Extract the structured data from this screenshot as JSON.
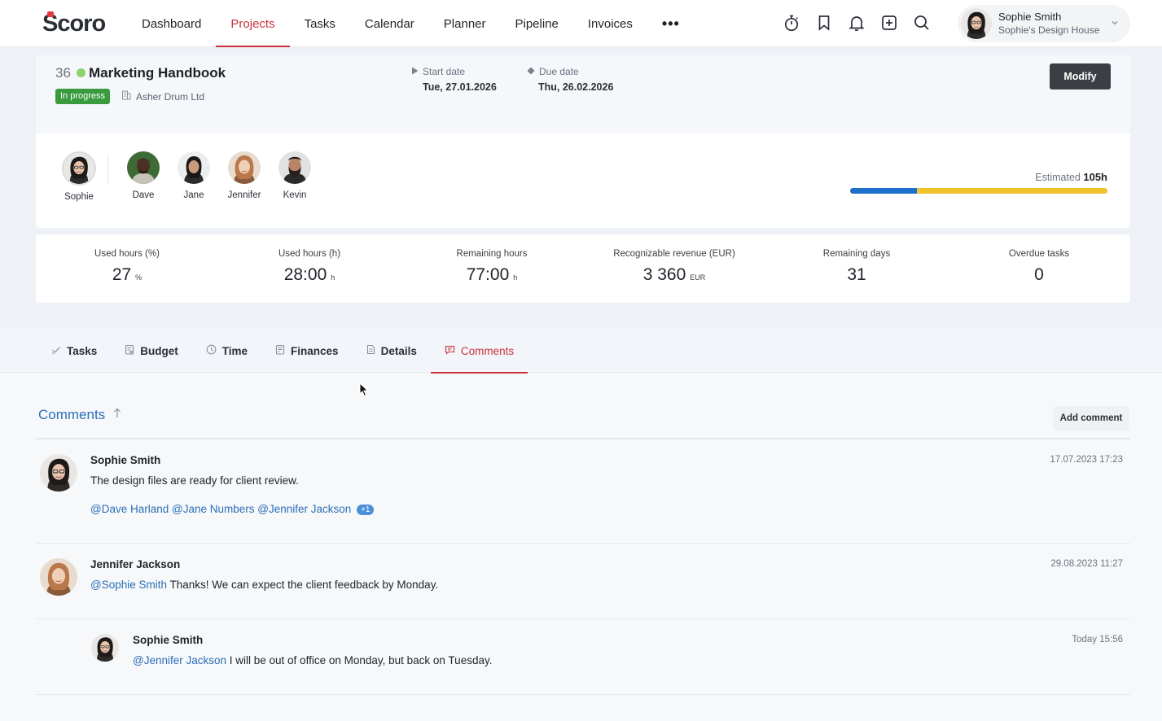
{
  "nav": {
    "logo": "Scoro",
    "items": [
      {
        "label": "Dashboard",
        "active": false
      },
      {
        "label": "Projects",
        "active": true
      },
      {
        "label": "Tasks",
        "active": false
      },
      {
        "label": "Calendar",
        "active": false
      },
      {
        "label": "Planner",
        "active": false
      },
      {
        "label": "Pipeline",
        "active": false
      },
      {
        "label": "Invoices",
        "active": false
      }
    ],
    "more_label": "•••",
    "icons": [
      "stopwatch-icon",
      "bookmark-icon",
      "bell-icon",
      "add-icon",
      "search-icon"
    ],
    "user": {
      "name": "Sophie Smith",
      "company": "Sophie's Design House"
    }
  },
  "project": {
    "id": "36",
    "title": "Marketing Handbook",
    "status": "In progress",
    "client": "Asher Drum Ltd",
    "start_label": "Start date",
    "start_value": "Tue, 27.01.2026",
    "due_label": "Due date",
    "due_value": "Thu, 26.02.2026",
    "modify_label": "Modify",
    "estimated_label": "Estimated",
    "estimated_value": "105h",
    "progress_fraction": 0.26,
    "colors": {
      "status": "#3a9a3e",
      "progress_used": "#1f6fcc",
      "progress_remaining": "#f0c22d",
      "accent": "#c9323c",
      "link": "#2a6fb8"
    }
  },
  "team": [
    {
      "name": "Sophie"
    },
    {
      "name": "Dave"
    },
    {
      "name": "Jane"
    },
    {
      "name": "Jennifer"
    },
    {
      "name": "Kevin"
    }
  ],
  "stats": [
    {
      "label": "Used hours (%)",
      "value": "27",
      "unit": "%"
    },
    {
      "label": "Used hours (h)",
      "value": "28:00",
      "unit": "h"
    },
    {
      "label": "Remaining hours",
      "value": "77:00",
      "unit": "h"
    },
    {
      "label": "Recognizable revenue (EUR)",
      "value": "3 360",
      "unit": "EUR"
    },
    {
      "label": "Remaining days",
      "value": "31",
      "unit": ""
    },
    {
      "label": "Overdue tasks",
      "value": "0",
      "unit": ""
    }
  ],
  "tabs": [
    {
      "label": "Tasks",
      "icon": "check-icon",
      "active": false
    },
    {
      "label": "Budget",
      "icon": "budget-icon",
      "active": false
    },
    {
      "label": "Time",
      "icon": "clock-icon",
      "active": false
    },
    {
      "label": "Finances",
      "icon": "finances-icon",
      "active": false
    },
    {
      "label": "Details",
      "icon": "document-icon",
      "active": false
    },
    {
      "label": "Comments",
      "icon": "comment-icon",
      "active": true
    }
  ],
  "comments": {
    "title": "Comments",
    "add_label": "Add comment",
    "items": [
      {
        "author": "Sophie Smith",
        "date": "17.07.2023 17:23",
        "text": "The design files are ready for client review.",
        "mentions": [
          "@Dave Harland",
          "@Jane Numbers",
          "@Jennifer Jackson"
        ],
        "more": "+1"
      },
      {
        "author": "Jennifer Jackson",
        "date": "29.08.2023 11:27",
        "mention": "@Sophie Smith",
        "text": " Thanks! We can expect the client feedback by Monday."
      },
      {
        "author": "Sophie Smith",
        "date": "Today 15:56",
        "mention": "@Jennifer Jackson",
        "text": " I will be out of office on Monday, but back on Tuesday."
      }
    ]
  }
}
